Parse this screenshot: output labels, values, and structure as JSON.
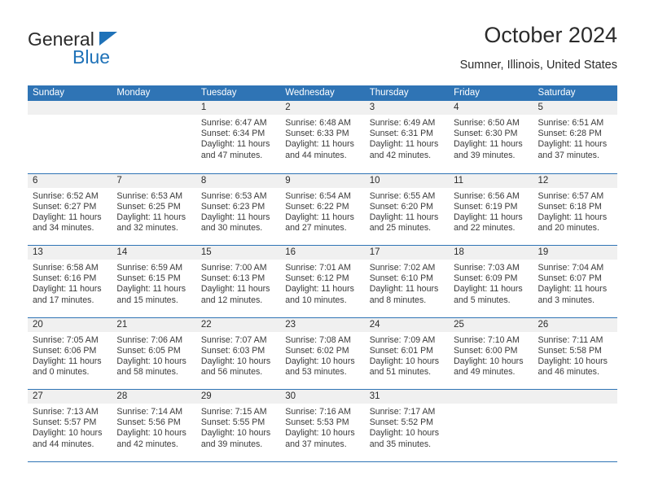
{
  "brand": {
    "name_part1": "General",
    "name_part2": "Blue",
    "triangle_icon": "triangle-icon",
    "accent_color": "#1f72b8"
  },
  "header": {
    "title": "October 2024",
    "subtitle": "Sumner, Illinois, United States"
  },
  "calendar": {
    "header_color": "#2f74b5",
    "daynum_band_color": "#f0f0f0",
    "weekday_labels": [
      "Sunday",
      "Monday",
      "Tuesday",
      "Wednesday",
      "Thursday",
      "Friday",
      "Saturday"
    ],
    "weeks": [
      [
        {
          "day": "",
          "sunrise": "",
          "sunset": "",
          "daylight1": "",
          "daylight2": ""
        },
        {
          "day": "",
          "sunrise": "",
          "sunset": "",
          "daylight1": "",
          "daylight2": ""
        },
        {
          "day": "1",
          "sunrise": "Sunrise: 6:47 AM",
          "sunset": "Sunset: 6:34 PM",
          "daylight1": "Daylight: 11 hours",
          "daylight2": "and 47 minutes."
        },
        {
          "day": "2",
          "sunrise": "Sunrise: 6:48 AM",
          "sunset": "Sunset: 6:33 PM",
          "daylight1": "Daylight: 11 hours",
          "daylight2": "and 44 minutes."
        },
        {
          "day": "3",
          "sunrise": "Sunrise: 6:49 AM",
          "sunset": "Sunset: 6:31 PM",
          "daylight1": "Daylight: 11 hours",
          "daylight2": "and 42 minutes."
        },
        {
          "day": "4",
          "sunrise": "Sunrise: 6:50 AM",
          "sunset": "Sunset: 6:30 PM",
          "daylight1": "Daylight: 11 hours",
          "daylight2": "and 39 minutes."
        },
        {
          "day": "5",
          "sunrise": "Sunrise: 6:51 AM",
          "sunset": "Sunset: 6:28 PM",
          "daylight1": "Daylight: 11 hours",
          "daylight2": "and 37 minutes."
        }
      ],
      [
        {
          "day": "6",
          "sunrise": "Sunrise: 6:52 AM",
          "sunset": "Sunset: 6:27 PM",
          "daylight1": "Daylight: 11 hours",
          "daylight2": "and 34 minutes."
        },
        {
          "day": "7",
          "sunrise": "Sunrise: 6:53 AM",
          "sunset": "Sunset: 6:25 PM",
          "daylight1": "Daylight: 11 hours",
          "daylight2": "and 32 minutes."
        },
        {
          "day": "8",
          "sunrise": "Sunrise: 6:53 AM",
          "sunset": "Sunset: 6:23 PM",
          "daylight1": "Daylight: 11 hours",
          "daylight2": "and 30 minutes."
        },
        {
          "day": "9",
          "sunrise": "Sunrise: 6:54 AM",
          "sunset": "Sunset: 6:22 PM",
          "daylight1": "Daylight: 11 hours",
          "daylight2": "and 27 minutes."
        },
        {
          "day": "10",
          "sunrise": "Sunrise: 6:55 AM",
          "sunset": "Sunset: 6:20 PM",
          "daylight1": "Daylight: 11 hours",
          "daylight2": "and 25 minutes."
        },
        {
          "day": "11",
          "sunrise": "Sunrise: 6:56 AM",
          "sunset": "Sunset: 6:19 PM",
          "daylight1": "Daylight: 11 hours",
          "daylight2": "and 22 minutes."
        },
        {
          "day": "12",
          "sunrise": "Sunrise: 6:57 AM",
          "sunset": "Sunset: 6:18 PM",
          "daylight1": "Daylight: 11 hours",
          "daylight2": "and 20 minutes."
        }
      ],
      [
        {
          "day": "13",
          "sunrise": "Sunrise: 6:58 AM",
          "sunset": "Sunset: 6:16 PM",
          "daylight1": "Daylight: 11 hours",
          "daylight2": "and 17 minutes."
        },
        {
          "day": "14",
          "sunrise": "Sunrise: 6:59 AM",
          "sunset": "Sunset: 6:15 PM",
          "daylight1": "Daylight: 11 hours",
          "daylight2": "and 15 minutes."
        },
        {
          "day": "15",
          "sunrise": "Sunrise: 7:00 AM",
          "sunset": "Sunset: 6:13 PM",
          "daylight1": "Daylight: 11 hours",
          "daylight2": "and 12 minutes."
        },
        {
          "day": "16",
          "sunrise": "Sunrise: 7:01 AM",
          "sunset": "Sunset: 6:12 PM",
          "daylight1": "Daylight: 11 hours",
          "daylight2": "and 10 minutes."
        },
        {
          "day": "17",
          "sunrise": "Sunrise: 7:02 AM",
          "sunset": "Sunset: 6:10 PM",
          "daylight1": "Daylight: 11 hours",
          "daylight2": "and 8 minutes."
        },
        {
          "day": "18",
          "sunrise": "Sunrise: 7:03 AM",
          "sunset": "Sunset: 6:09 PM",
          "daylight1": "Daylight: 11 hours",
          "daylight2": "and 5 minutes."
        },
        {
          "day": "19",
          "sunrise": "Sunrise: 7:04 AM",
          "sunset": "Sunset: 6:07 PM",
          "daylight1": "Daylight: 11 hours",
          "daylight2": "and 3 minutes."
        }
      ],
      [
        {
          "day": "20",
          "sunrise": "Sunrise: 7:05 AM",
          "sunset": "Sunset: 6:06 PM",
          "daylight1": "Daylight: 11 hours",
          "daylight2": "and 0 minutes."
        },
        {
          "day": "21",
          "sunrise": "Sunrise: 7:06 AM",
          "sunset": "Sunset: 6:05 PM",
          "daylight1": "Daylight: 10 hours",
          "daylight2": "and 58 minutes."
        },
        {
          "day": "22",
          "sunrise": "Sunrise: 7:07 AM",
          "sunset": "Sunset: 6:03 PM",
          "daylight1": "Daylight: 10 hours",
          "daylight2": "and 56 minutes."
        },
        {
          "day": "23",
          "sunrise": "Sunrise: 7:08 AM",
          "sunset": "Sunset: 6:02 PM",
          "daylight1": "Daylight: 10 hours",
          "daylight2": "and 53 minutes."
        },
        {
          "day": "24",
          "sunrise": "Sunrise: 7:09 AM",
          "sunset": "Sunset: 6:01 PM",
          "daylight1": "Daylight: 10 hours",
          "daylight2": "and 51 minutes."
        },
        {
          "day": "25",
          "sunrise": "Sunrise: 7:10 AM",
          "sunset": "Sunset: 6:00 PM",
          "daylight1": "Daylight: 10 hours",
          "daylight2": "and 49 minutes."
        },
        {
          "day": "26",
          "sunrise": "Sunrise: 7:11 AM",
          "sunset": "Sunset: 5:58 PM",
          "daylight1": "Daylight: 10 hours",
          "daylight2": "and 46 minutes."
        }
      ],
      [
        {
          "day": "27",
          "sunrise": "Sunrise: 7:13 AM",
          "sunset": "Sunset: 5:57 PM",
          "daylight1": "Daylight: 10 hours",
          "daylight2": "and 44 minutes."
        },
        {
          "day": "28",
          "sunrise": "Sunrise: 7:14 AM",
          "sunset": "Sunset: 5:56 PM",
          "daylight1": "Daylight: 10 hours",
          "daylight2": "and 42 minutes."
        },
        {
          "day": "29",
          "sunrise": "Sunrise: 7:15 AM",
          "sunset": "Sunset: 5:55 PM",
          "daylight1": "Daylight: 10 hours",
          "daylight2": "and 39 minutes."
        },
        {
          "day": "30",
          "sunrise": "Sunrise: 7:16 AM",
          "sunset": "Sunset: 5:53 PM",
          "daylight1": "Daylight: 10 hours",
          "daylight2": "and 37 minutes."
        },
        {
          "day": "31",
          "sunrise": "Sunrise: 7:17 AM",
          "sunset": "Sunset: 5:52 PM",
          "daylight1": "Daylight: 10 hours",
          "daylight2": "and 35 minutes."
        },
        {
          "day": "",
          "sunrise": "",
          "sunset": "",
          "daylight1": "",
          "daylight2": ""
        },
        {
          "day": "",
          "sunrise": "",
          "sunset": "",
          "daylight1": "",
          "daylight2": ""
        }
      ]
    ]
  }
}
